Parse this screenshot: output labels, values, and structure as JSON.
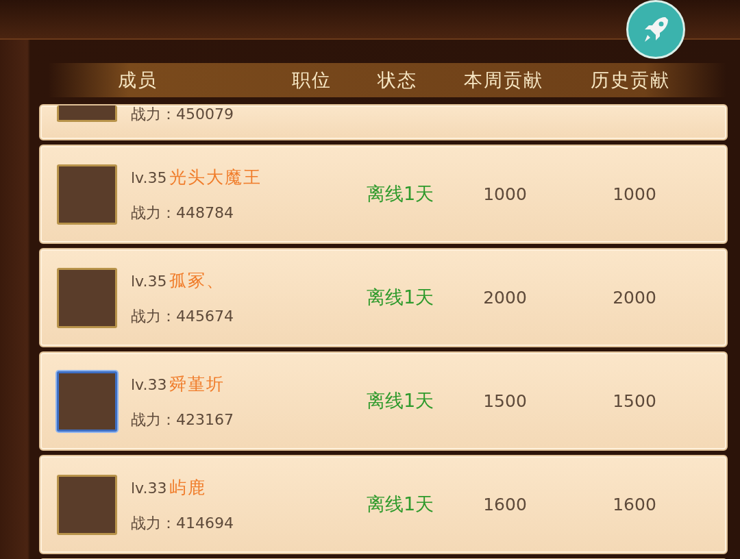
{
  "header": {
    "columns": [
      "成员",
      "职位",
      "状态",
      "本周贡献",
      "历史贡献"
    ]
  },
  "partial_row": {
    "power_label": "战力：",
    "power": "450079"
  },
  "members": [
    {
      "level": "lv.35",
      "name": "光头大魔王",
      "power_label": "战力：",
      "power": "448784",
      "status": "离线1天",
      "weekly": "1000",
      "history": "1000",
      "highlighted": false
    },
    {
      "level": "lv.35",
      "name": "孤冢、",
      "power_label": "战力：",
      "power": "445674",
      "status": "离线1天",
      "weekly": "2000",
      "history": "2000",
      "highlighted": false
    },
    {
      "level": "lv.33",
      "name": "舜堇圻",
      "power_label": "战力：",
      "power": "423167",
      "status": "离线1天",
      "weekly": "1500",
      "history": "1500",
      "highlighted": true
    },
    {
      "level": "lv.33",
      "name": "屿鹿",
      "power_label": "战力：",
      "power": "414694",
      "status": "离线1天",
      "weekly": "1600",
      "history": "1600",
      "highlighted": false
    }
  ]
}
